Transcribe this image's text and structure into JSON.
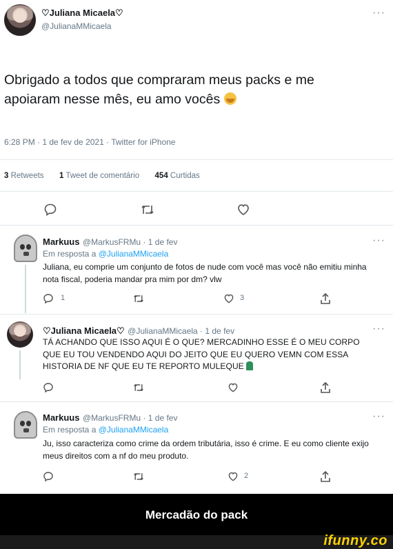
{
  "main_tweet": {
    "name": "♡Juliana Micaela♡",
    "handle": "@JulianaMMicaela",
    "more": "···",
    "text": "Obrigado a todos que compraram meus packs e me apoiaram nesse mês, eu amo vocês",
    "meta": "6:28 PM · 1 de fev de 2021 · Twitter for iPhone",
    "stats": {
      "retweets_count": "3",
      "retweets_label": "Retweets",
      "comments_count": "1",
      "comments_label": "Tweet de comentário",
      "likes_count": "454",
      "likes_label": "Curtidas"
    }
  },
  "replies": [
    {
      "name": "Markuus",
      "handle_date": "@MarkusFRMu · 1 de fev",
      "reply_prefix": "Em resposta a",
      "reply_to": "@JulianaMMicaela",
      "text": "Juliana, eu comprie um conjunto de fotos de nude com você mas você não emitiu minha nota fiscal, poderia mandar pra mim por dm? vlw",
      "reply_count": "1",
      "like_count": "3"
    },
    {
      "name": "♡Juliana Micaela♡",
      "handle_date": "@JulianaMMicaela · 1 de fev",
      "text": "TÁ ACHANDO QUE ISSO AQUI É O QUE? MERCADINHO ESSE É O MEU CORPO QUE EU TOU VENDENDO AQUI DO JEITO QUE EU QUERO VEMN COM ESSA HISTORIA DE NF QUE EU TE REPORTO MULEQUE"
    },
    {
      "name": "Markuus",
      "handle_date": "@MarkusFRMu · 1 de fev",
      "reply_prefix": "Em resposta a",
      "reply_to": "@JulianaMMicaela",
      "text": "Ju, isso caracteriza como crime da ordem tributária, isso é crime. E eu como cliente exijo meus direitos com a nf do meu produto.",
      "like_count": "2"
    }
  ],
  "caption": "Mercadão do pack",
  "watermark": "ifunny.co",
  "icons": [
    "reply-icon",
    "retweet-icon",
    "like-icon",
    "share-icon",
    "more-icon"
  ],
  "colors": {
    "accent": "#1da1f2",
    "watermark": "#ffd200",
    "muted": "#657786"
  }
}
